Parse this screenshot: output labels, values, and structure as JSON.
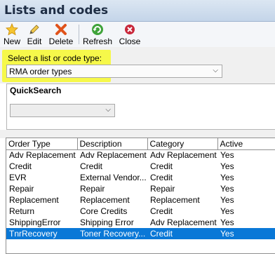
{
  "window": {
    "title": "Lists and codes"
  },
  "toolbar": {
    "new_label": "New",
    "edit_label": "Edit",
    "delete_label": "Delete",
    "refresh_label": "Refresh",
    "close_label": "Close"
  },
  "type_selector": {
    "label": "Select a list or code type:",
    "value": "RMA order types"
  },
  "quick_search": {
    "label": "QuickSearch",
    "value": ""
  },
  "colors": {
    "highlight": "#f6f84a",
    "selected_row": "#0a78d7",
    "title_bar": "#c4d5e9"
  },
  "table": {
    "headers": [
      "Order Type",
      "Description",
      "Category",
      "Active"
    ],
    "rows": [
      {
        "cells": [
          "Adv Replacement",
          "Adv Replacement",
          "Adv Replacement",
          "Yes"
        ],
        "selected": false
      },
      {
        "cells": [
          "Credit",
          "Credit",
          "Credit",
          "Yes"
        ],
        "selected": false
      },
      {
        "cells": [
          "EVR",
          "External Vendor...",
          "Credit",
          "Yes"
        ],
        "selected": false
      },
      {
        "cells": [
          "Repair",
          "Repair",
          "Repair",
          "Yes"
        ],
        "selected": false
      },
      {
        "cells": [
          "Replacement",
          "Replacement",
          "Replacement",
          "Yes"
        ],
        "selected": false
      },
      {
        "cells": [
          "Return",
          "Core Credits",
          "Credit",
          "Yes"
        ],
        "selected": false
      },
      {
        "cells": [
          "ShippingError",
          "Shipping Error",
          "Adv Replacement",
          "Yes"
        ],
        "selected": false
      },
      {
        "cells": [
          "TnrRecovery",
          "Toner Recovery...",
          "Credit",
          "Yes"
        ],
        "selected": true
      }
    ]
  }
}
